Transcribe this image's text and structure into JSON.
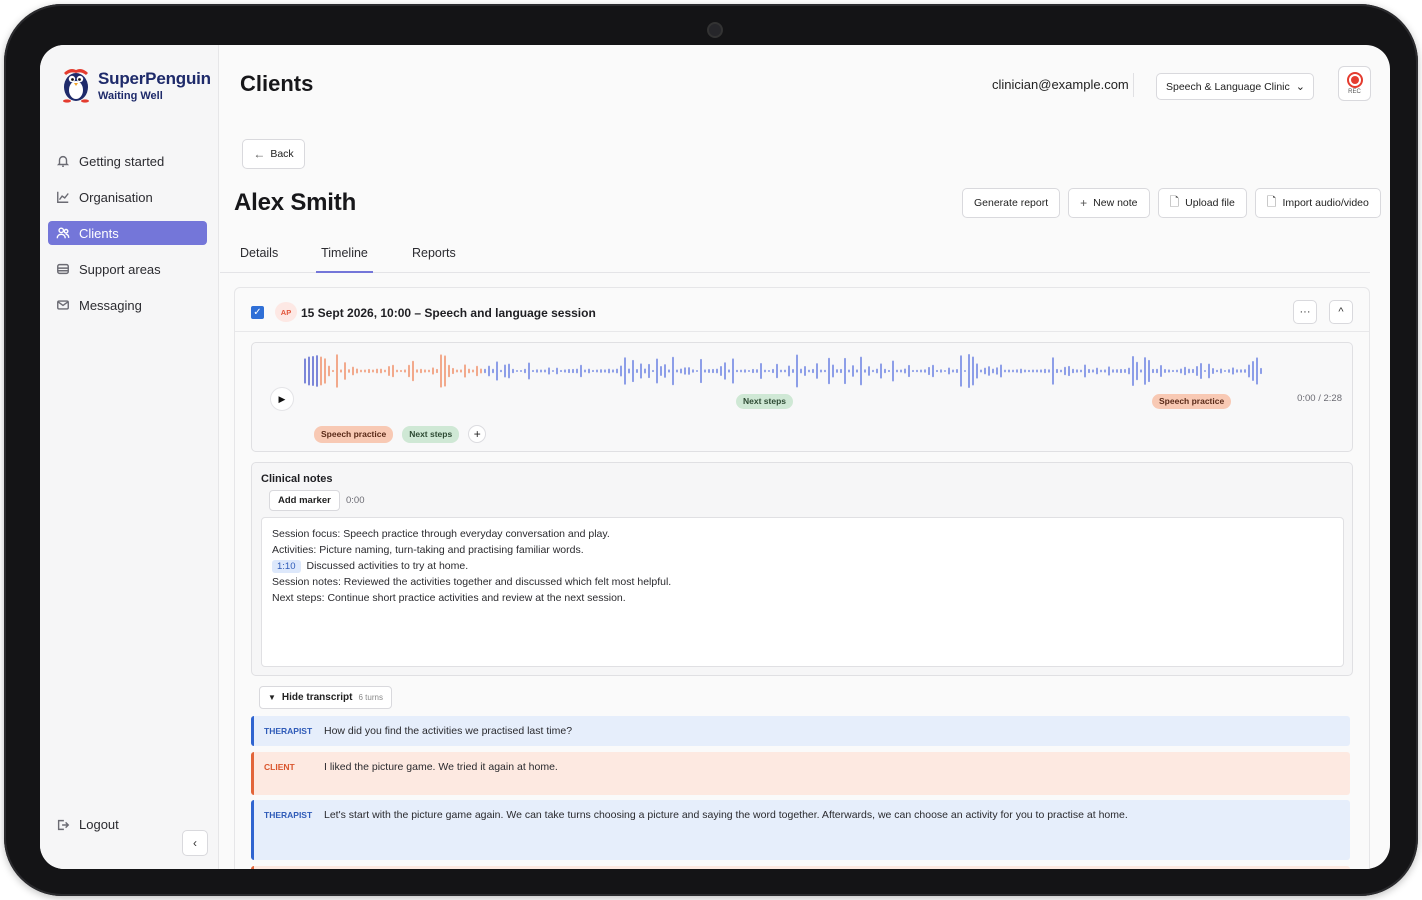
{
  "brand": {
    "name": "SuperPenguin",
    "tagline": "Waiting Well"
  },
  "sidebar": {
    "items": [
      {
        "label": "Getting started",
        "icon": "bell-icon",
        "active": false
      },
      {
        "label": "Organisation",
        "icon": "chart-icon",
        "active": false
      },
      {
        "label": "Clients",
        "icon": "users-icon",
        "active": true
      },
      {
        "label": "Support areas",
        "icon": "layers-icon",
        "active": false
      },
      {
        "label": "Messaging",
        "icon": "mail-icon",
        "active": false
      }
    ],
    "logout_label": "Logout"
  },
  "header": {
    "title": "Clients",
    "user_email": "clinician@example.com",
    "clinic": "Speech & Language Clinic",
    "rec_label": "REC"
  },
  "client": {
    "back_label": "Back",
    "name": "Alex Smith",
    "actions": [
      "Generate report",
      "New note",
      "Upload file",
      "Import audio/video"
    ]
  },
  "tabs": [
    "Details",
    "Timeline",
    "Reports"
  ],
  "active_tab": "Timeline",
  "session": {
    "initials": "AP",
    "title": "15 Sept 2026, 10:00  –  Speech and language session",
    "more_label": "···",
    "collapse_label": "^",
    "audio": {
      "time": "0:00 / 2:28",
      "wave_markers": [
        {
          "label": "Next steps",
          "kind": "green"
        },
        {
          "label": "Speech practice",
          "kind": "orange"
        }
      ],
      "tags": [
        {
          "label": "Speech practice",
          "kind": "orange"
        },
        {
          "label": "Next steps",
          "kind": "green"
        }
      ],
      "add_tag_label": "+"
    },
    "notes": {
      "title": "Clinical notes",
      "add_marker_label": "Add marker",
      "marker_time": "0:00",
      "lines": [
        {
          "text": "Session focus: Speech practice through everyday conversation and play."
        },
        {
          "text": "Activities: Picture naming, turn-taking and practising familiar words."
        },
        {
          "chip": "1:10",
          "text": "Discussed activities to try at home."
        },
        {
          "text": "Session notes: Reviewed the activities together and discussed which felt most helpful."
        },
        {
          "text": "Next steps: Continue short practice activities and review at the next session."
        }
      ]
    },
    "transcript": {
      "toggle_label": "Hide transcript",
      "turns_count": "6 turns",
      "turns": [
        {
          "speaker": "THERAPIST",
          "text": "How did you find the activities we practised last time?"
        },
        {
          "speaker": "CLIENT",
          "text": "I liked the picture game. We tried it again at home."
        },
        {
          "speaker": "THERAPIST",
          "text": "Let's start with the picture game again. We can take turns choosing a picture and saying the word together. Afterwards, we can choose an activity for you to practise at home."
        }
      ]
    }
  },
  "colors": {
    "accent": "#7476d9",
    "therapist": "#2f64d0",
    "client": "#e2653a",
    "rec": "#e43c2f"
  }
}
